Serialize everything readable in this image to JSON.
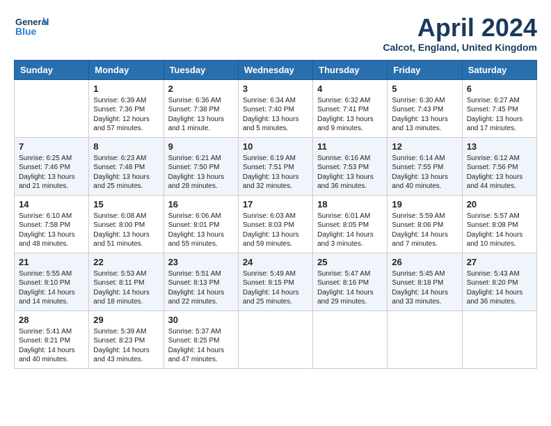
{
  "logo": {
    "line1": "General",
    "line2": "Blue"
  },
  "title": "April 2024",
  "subtitle": "Calcot, England, United Kingdom",
  "days_header": [
    "Sunday",
    "Monday",
    "Tuesday",
    "Wednesday",
    "Thursday",
    "Friday",
    "Saturday"
  ],
  "weeks": [
    [
      {
        "num": "",
        "data": ""
      },
      {
        "num": "1",
        "data": "Sunrise: 6:39 AM\nSunset: 7:36 PM\nDaylight: 12 hours\nand 57 minutes."
      },
      {
        "num": "2",
        "data": "Sunrise: 6:36 AM\nSunset: 7:38 PM\nDaylight: 13 hours\nand 1 minute."
      },
      {
        "num": "3",
        "data": "Sunrise: 6:34 AM\nSunset: 7:40 PM\nDaylight: 13 hours\nand 5 minutes."
      },
      {
        "num": "4",
        "data": "Sunrise: 6:32 AM\nSunset: 7:41 PM\nDaylight: 13 hours\nand 9 minutes."
      },
      {
        "num": "5",
        "data": "Sunrise: 6:30 AM\nSunset: 7:43 PM\nDaylight: 13 hours\nand 13 minutes."
      },
      {
        "num": "6",
        "data": "Sunrise: 6:27 AM\nSunset: 7:45 PM\nDaylight: 13 hours\nand 17 minutes."
      }
    ],
    [
      {
        "num": "7",
        "data": "Sunrise: 6:25 AM\nSunset: 7:46 PM\nDaylight: 13 hours\nand 21 minutes."
      },
      {
        "num": "8",
        "data": "Sunrise: 6:23 AM\nSunset: 7:48 PM\nDaylight: 13 hours\nand 25 minutes."
      },
      {
        "num": "9",
        "data": "Sunrise: 6:21 AM\nSunset: 7:50 PM\nDaylight: 13 hours\nand 28 minutes."
      },
      {
        "num": "10",
        "data": "Sunrise: 6:19 AM\nSunset: 7:51 PM\nDaylight: 13 hours\nand 32 minutes."
      },
      {
        "num": "11",
        "data": "Sunrise: 6:16 AM\nSunset: 7:53 PM\nDaylight: 13 hours\nand 36 minutes."
      },
      {
        "num": "12",
        "data": "Sunrise: 6:14 AM\nSunset: 7:55 PM\nDaylight: 13 hours\nand 40 minutes."
      },
      {
        "num": "13",
        "data": "Sunrise: 6:12 AM\nSunset: 7:56 PM\nDaylight: 13 hours\nand 44 minutes."
      }
    ],
    [
      {
        "num": "14",
        "data": "Sunrise: 6:10 AM\nSunset: 7:58 PM\nDaylight: 13 hours\nand 48 minutes."
      },
      {
        "num": "15",
        "data": "Sunrise: 6:08 AM\nSunset: 8:00 PM\nDaylight: 13 hours\nand 51 minutes."
      },
      {
        "num": "16",
        "data": "Sunrise: 6:06 AM\nSunset: 8:01 PM\nDaylight: 13 hours\nand 55 minutes."
      },
      {
        "num": "17",
        "data": "Sunrise: 6:03 AM\nSunset: 8:03 PM\nDaylight: 13 hours\nand 59 minutes."
      },
      {
        "num": "18",
        "data": "Sunrise: 6:01 AM\nSunset: 8:05 PM\nDaylight: 14 hours\nand 3 minutes."
      },
      {
        "num": "19",
        "data": "Sunrise: 5:59 AM\nSunset: 8:06 PM\nDaylight: 14 hours\nand 7 minutes."
      },
      {
        "num": "20",
        "data": "Sunrise: 5:57 AM\nSunset: 8:08 PM\nDaylight: 14 hours\nand 10 minutes."
      }
    ],
    [
      {
        "num": "21",
        "data": "Sunrise: 5:55 AM\nSunset: 8:10 PM\nDaylight: 14 hours\nand 14 minutes."
      },
      {
        "num": "22",
        "data": "Sunrise: 5:53 AM\nSunset: 8:11 PM\nDaylight: 14 hours\nand 18 minutes."
      },
      {
        "num": "23",
        "data": "Sunrise: 5:51 AM\nSunset: 8:13 PM\nDaylight: 14 hours\nand 22 minutes."
      },
      {
        "num": "24",
        "data": "Sunrise: 5:49 AM\nSunset: 8:15 PM\nDaylight: 14 hours\nand 25 minutes."
      },
      {
        "num": "25",
        "data": "Sunrise: 5:47 AM\nSunset: 8:16 PM\nDaylight: 14 hours\nand 29 minutes."
      },
      {
        "num": "26",
        "data": "Sunrise: 5:45 AM\nSunset: 8:18 PM\nDaylight: 14 hours\nand 33 minutes."
      },
      {
        "num": "27",
        "data": "Sunrise: 5:43 AM\nSunset: 8:20 PM\nDaylight: 14 hours\nand 36 minutes."
      }
    ],
    [
      {
        "num": "28",
        "data": "Sunrise: 5:41 AM\nSunset: 8:21 PM\nDaylight: 14 hours\nand 40 minutes."
      },
      {
        "num": "29",
        "data": "Sunrise: 5:39 AM\nSunset: 8:23 PM\nDaylight: 14 hours\nand 43 minutes."
      },
      {
        "num": "30",
        "data": "Sunrise: 5:37 AM\nSunset: 8:25 PM\nDaylight: 14 hours\nand 47 minutes."
      },
      {
        "num": "",
        "data": ""
      },
      {
        "num": "",
        "data": ""
      },
      {
        "num": "",
        "data": ""
      },
      {
        "num": "",
        "data": ""
      }
    ]
  ]
}
